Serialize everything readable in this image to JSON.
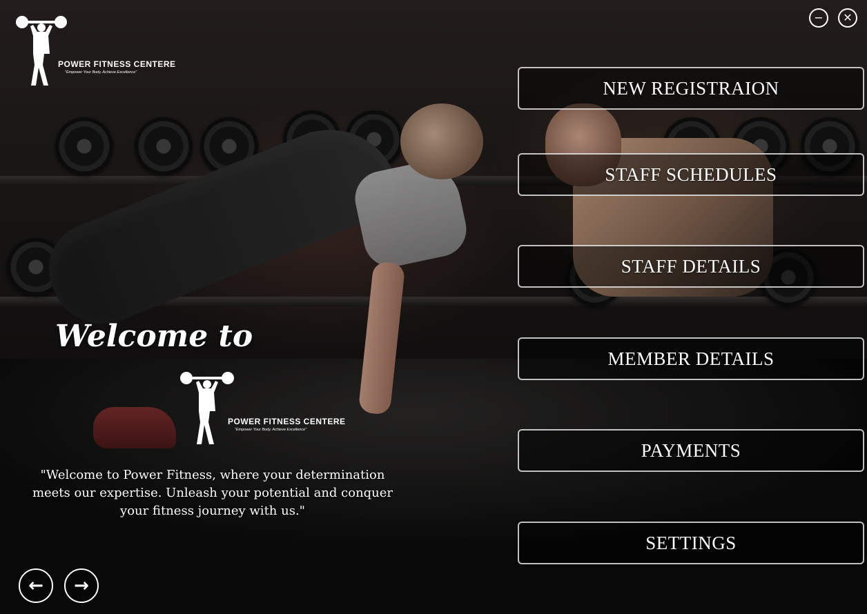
{
  "app": {
    "brand_name": "POWER FITNESS CENTERE",
    "brand_tagline": "\"Empower Your Body. Achieve Excellence\""
  },
  "window_controls": {
    "minimize_icon": "minus-circle-icon",
    "minimize_glyph": "−",
    "close_icon": "x-circle-icon",
    "close_glyph": "✕"
  },
  "menu": {
    "items": [
      {
        "label": "NEW REGISTRAION"
      },
      {
        "label": "STAFF SCHEDULES"
      },
      {
        "label": "STAFF  DETAILS"
      },
      {
        "label": "MEMBER DETAILS"
      },
      {
        "label": "PAYMENTS"
      },
      {
        "label": "SETTINGS"
      }
    ]
  },
  "welcome": {
    "title": "Welcome to",
    "brand_name": "POWER FITNESS CENTERE",
    "brand_tagline": "\"Empower Your Body. Achieve Excellence\"",
    "quote": "\"Welcome to Power Fitness, where your determination meets our expertise. Unleash your potential and conquer your fitness journey with us.\""
  },
  "navigation": {
    "prev_icon": "arrow-left-icon",
    "prev_glyph": "←",
    "next_icon": "arrow-right-icon",
    "next_glyph": "→"
  }
}
